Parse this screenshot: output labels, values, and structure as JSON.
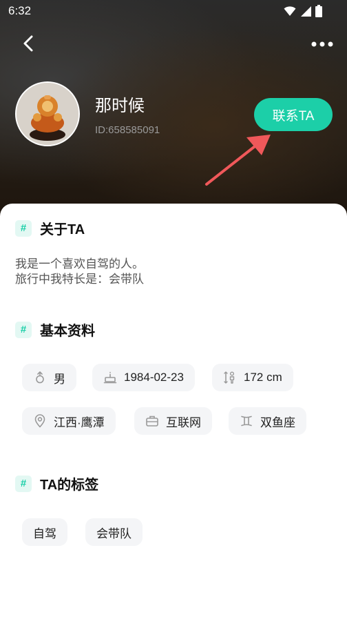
{
  "status_bar": {
    "time": "6:32"
  },
  "profile": {
    "name": "那时候",
    "user_id": "ID:658585091",
    "contact_button_label": "联系TA"
  },
  "about": {
    "title": "关于TA",
    "line1": "我是一个喜欢自驾的人。",
    "line2": "旅行中我特长是：会带队"
  },
  "basic_info": {
    "title": "基本资料",
    "items": [
      {
        "label": "男",
        "icon": "gender-icon"
      },
      {
        "label": "1984-02-23",
        "icon": "birthday-cake-icon"
      },
      {
        "label": "172 cm",
        "icon": "height-icon"
      },
      {
        "label": "江西·鹰潭",
        "icon": "location-pin-icon"
      },
      {
        "label": "互联网",
        "icon": "briefcase-icon"
      },
      {
        "label": "双鱼座",
        "icon": "zodiac-icon"
      }
    ]
  },
  "tags": {
    "title": "TA的标签",
    "items": [
      "自驾",
      "会带队"
    ]
  },
  "section_marker": "#",
  "colors": {
    "accent": "#1ccfa8",
    "annotation_arrow": "#f0585a"
  }
}
